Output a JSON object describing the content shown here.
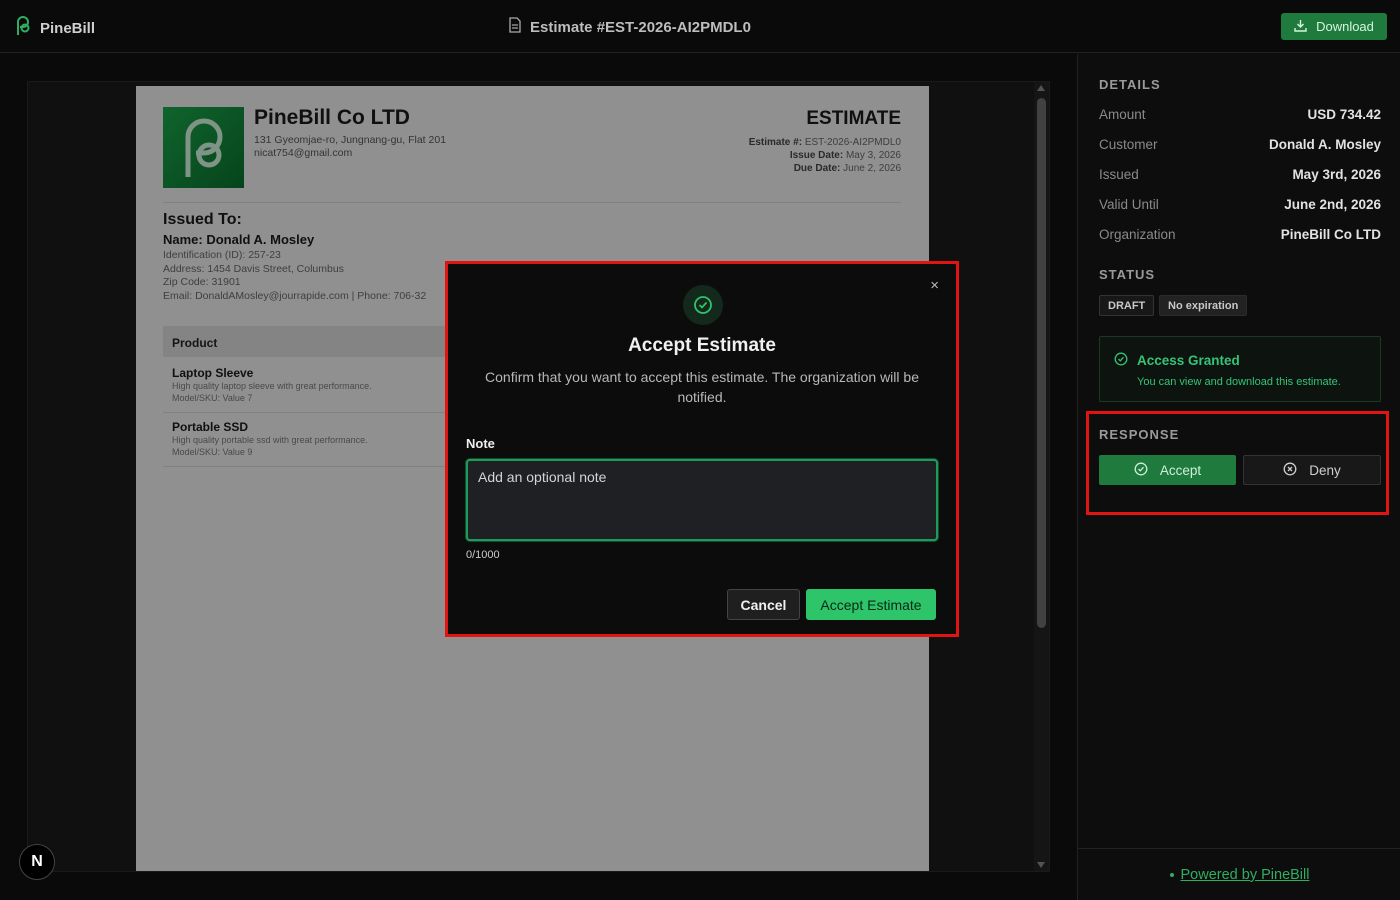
{
  "app": {
    "brand": "PineBill"
  },
  "header": {
    "title": "Estimate #EST-2026-AI2PMDL0",
    "download_label": "Download"
  },
  "document": {
    "company_name": "PineBill Co LTD",
    "company_address": "131 Gyeomjae-ro, Jungnang-gu, Flat 201",
    "company_email": "nicat754@gmail.com",
    "doc_type": "ESTIMATE",
    "estimate_label": "Estimate #:",
    "estimate_number": "EST-2026-AI2PMDL0",
    "issue_label": "Issue Date:",
    "issue_date": "May 3, 2026",
    "due_label": "Due Date:",
    "due_date": "June 2, 2026",
    "issued_to_title": "Issued To:",
    "customer_name": "Name: Donald A. Mosley",
    "customer_id": "Identification (ID): 257-23",
    "customer_address": "Address: 1454 Davis Street, Columbus",
    "customer_zip": "Zip Code: 31901",
    "customer_contact": "Email: DonaldAMosley@jourrapide.com  |  Phone: 706-32",
    "table_header": "Product",
    "products": [
      {
        "name": "Laptop Sleeve",
        "desc": "High quality laptop sleeve with great performance.",
        "sku": "Model/SKU: Value 7"
      },
      {
        "name": "Portable SSD",
        "desc": "High quality portable ssd with great performance.",
        "sku": "Model/SKU: Value 9"
      }
    ]
  },
  "modal": {
    "title": "Accept Estimate",
    "description": "Confirm that you want to accept this estimate. The organization will be notified.",
    "note_label": "Note",
    "note_placeholder": "Add an optional note",
    "char_count": "0/1000",
    "cancel_label": "Cancel",
    "confirm_label": "Accept Estimate",
    "close_glyph": "×"
  },
  "sidebar": {
    "details_title": "DETAILS",
    "details": [
      {
        "label": "Amount",
        "value": "USD 734.42"
      },
      {
        "label": "Customer",
        "value": "Donald A. Mosley"
      },
      {
        "label": "Issued",
        "value": "May 3rd, 2026"
      },
      {
        "label": "Valid Until",
        "value": "June 2nd, 2026"
      },
      {
        "label": "Organization",
        "value": "PineBill Co LTD"
      }
    ],
    "status_title": "STATUS",
    "badges": [
      "DRAFT",
      "No expiration"
    ],
    "access_title": "Access Granted",
    "access_sub": "You can view and download this estimate.",
    "response_title": "RESPONSE",
    "accept_label": "Accept",
    "deny_label": "Deny",
    "footer_link": "Powered by PineBill"
  },
  "colors": {
    "accent": "#2dc46a",
    "brand_green": "#1f7a3e",
    "highlight": "#e21313"
  },
  "icons": [
    "pinebill-logo-icon",
    "document-icon",
    "download-icon",
    "check-circle-icon",
    "x-circle-icon",
    "close-icon",
    "nextjs-icon"
  ]
}
